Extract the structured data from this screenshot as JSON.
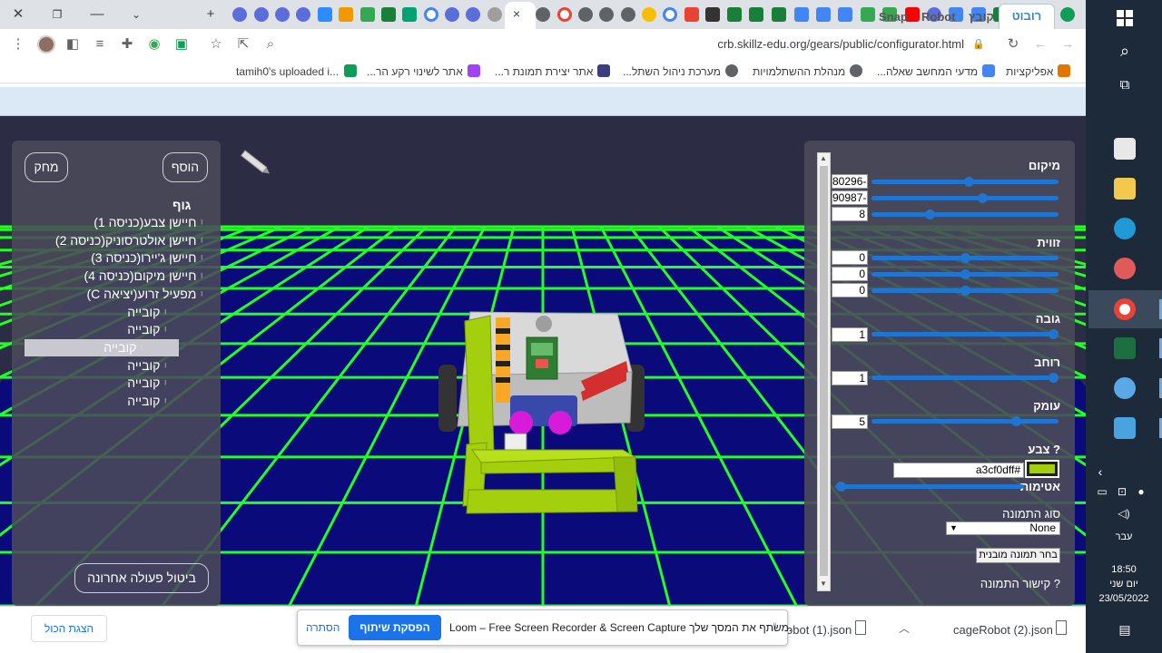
{
  "browser": {
    "url": "crb.skillz-edu.org/gears/public/configurator.html",
    "active_tab_close": "×",
    "new_tab_label": "+",
    "bookmarks": [
      {
        "label": "אפליקציות",
        "color": "#e37400"
      },
      {
        "label": "מדעי המחשב שאלה...",
        "color": "#4285f4"
      },
      {
        "label": "מנהלת ההשתלמויות",
        "color": "#5f6368"
      },
      {
        "label": "מערכת ניהול השתל...",
        "color": "#5f6368"
      },
      {
        "label": "אתר יצירת תמונת ר...",
        "color": "#3c3c80"
      },
      {
        "label": "אתר לשינוי רקע הר...",
        "color": "#a142f4"
      },
      {
        "label": "tamih0's uploaded i...",
        "color": "#0f9d58"
      }
    ]
  },
  "app": {
    "tabs": [
      "רובוט",
      "קובץ",
      "Robot",
      "Snap"
    ],
    "left_panel": {
      "add_button": "הוסף",
      "delete_button": "מחק",
      "undo_button": "ביטול פעולה אחרונה",
      "tree_root": "גוף",
      "tree_items": [
        {
          "label": "חיישן צבע(כניסה 1)",
          "level": 1,
          "selected": false
        },
        {
          "label": "חיישן אולטרסוניק(כניסה 2)",
          "level": 1,
          "selected": false
        },
        {
          "label": "חיישן ג'יירו(כניסה 3)",
          "level": 1,
          "selected": false
        },
        {
          "label": "חיישן מיקום(כניסה 4)",
          "level": 1,
          "selected": false
        },
        {
          "label": "מפעיל זרוע(יציאה C)",
          "level": 1,
          "selected": false
        },
        {
          "label": "קובייה",
          "level": 2,
          "selected": false
        },
        {
          "label": "קובייה",
          "level": 2,
          "selected": false
        },
        {
          "label": "קובייה",
          "level": 2,
          "selected": true
        },
        {
          "label": "קובייה",
          "level": 2,
          "selected": false
        },
        {
          "label": "קובייה",
          "level": 2,
          "selected": false
        },
        {
          "label": "קובייה",
          "level": 2,
          "selected": false
        }
      ]
    },
    "right_panel": {
      "position_label": "מיקום",
      "position": [
        {
          "value": "80296-",
          "slider": 0.52
        },
        {
          "value": "90987-",
          "slider": 0.59
        },
        {
          "value": "8",
          "slider": 0.31
        }
      ],
      "angle_label": "זווית",
      "angle": [
        {
          "value": "0",
          "slider": 0.5
        },
        {
          "value": "0",
          "slider": 0.5
        },
        {
          "value": "0",
          "slider": 0.5
        }
      ],
      "height_label": "גובה",
      "height": {
        "value": "1",
        "slider": 0.97
      },
      "width_label": "רוחב",
      "width": {
        "value": "1",
        "slider": 0.97
      },
      "depth_label": "עומק",
      "depth": {
        "value": "5",
        "slider": 0.77
      },
      "color_label": "צבע ?",
      "color_value": "a3cf0dff#",
      "color_swatch": "#a3cf0d",
      "opacity_label": "אטימות",
      "opacity": {
        "slider": 0.03
      },
      "image_type_label": "סוג התמונה",
      "image_type_value": "None",
      "builtin_image_button": "בחר תמונה מובנית",
      "image_link_label": "קישור התמונה ?"
    }
  },
  "downloads": {
    "files": [
      "cageRobot (2).json",
      "obot (1).json"
    ],
    "show_all": "הצגת הכול"
  },
  "loom": {
    "message": "Loom – Free Screen Recorder & Screen Capture משתף את המסך שלך.",
    "stop_button": "הפסקת שיתוף",
    "hide_button": "הסתרה"
  },
  "taskbar": {
    "lang": "עבר",
    "time": "18:50",
    "day": "יום שני",
    "date": "23/05/2022"
  },
  "colors": {
    "grid": "#22ff22",
    "floor": "#0a0a7a",
    "robot_green": "#a3cf0d",
    "accent": "#1f75cf"
  }
}
